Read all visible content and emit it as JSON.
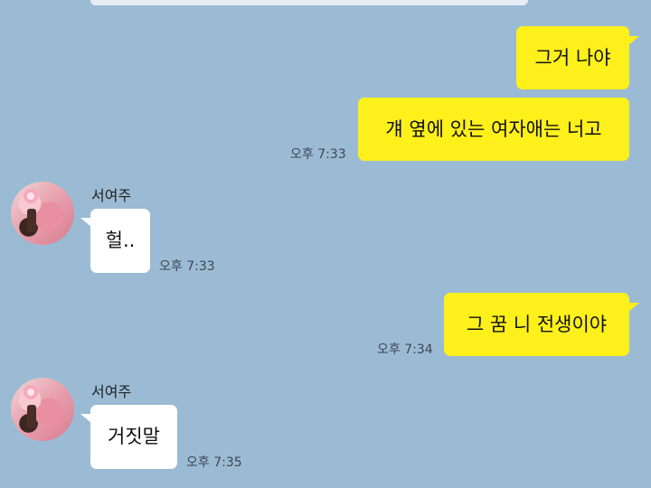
{
  "contact": {
    "name": "서여주"
  },
  "messages": [
    {
      "sender": "me",
      "text": "그거 나야"
    },
    {
      "sender": "me",
      "text": "걔 옆에 있는 여자애는 너고",
      "time": "오후 7:33"
    },
    {
      "sender": "other",
      "name": "서여주",
      "text": "헐..",
      "time": "오후 7:33"
    },
    {
      "sender": "me",
      "text": "그 꿈 니 전생이야",
      "time": "오후 7:34"
    },
    {
      "sender": "other",
      "name": "서여주",
      "text": "거짓말",
      "time": "오후 7:35"
    }
  ],
  "colors": {
    "background": "#9bbbd4",
    "my_bubble": "#fef01b",
    "their_bubble": "#ffffff"
  }
}
